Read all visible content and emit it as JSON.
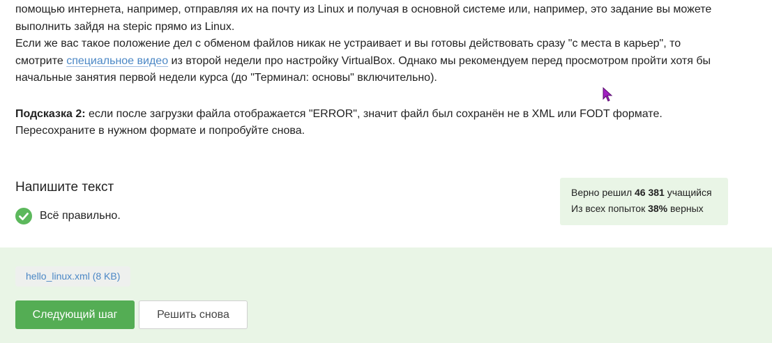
{
  "step_text": {
    "para1_line1": "помощью интернета, например, отправляя их на почту из Linux и получая в основной системе или, например, это задание вы можете",
    "para1_line2": "выполнить зайдя на stepic прямо из Linux.",
    "para2_part1": "Если же вас такое положение дел с обменом файлов никак не устраивает и вы готовы действовать сразу \"с места в карьер\", то",
    "para2_part2_before_link": "смотрите ",
    "para2_link": "специальное видео",
    "para2_part2_after_link": " из второй недели про настройку VirtualBox. Однако мы рекомендуем перед просмотром пройти хотя бы",
    "para2_part3": "начальные занятия первой недели курса (до \"Терминал: основы\" включительно).",
    "hint_label": "Подсказка 2:",
    "hint_text": " если после загрузки файла отображается \"ERROR\", значит файл был сохранён не в XML или FODT формате.",
    "hint_text2": "Пересохраните в нужном формате и попробуйте снова."
  },
  "task": {
    "title": "Напишите текст",
    "result_text": "Всё правильно."
  },
  "stats": {
    "solved_prefix": "Верно решил ",
    "solved_count": "46 381",
    "solved_suffix": " учащийся",
    "attempts_prefix": "Из всех попыток ",
    "attempts_percent": "38%",
    "attempts_suffix": " верных"
  },
  "footer": {
    "file_chip": "hello_linux.xml (8 KB)",
    "next_button": "Следующий шаг",
    "retry_button": "Решить снова"
  },
  "colors": {
    "accent_green": "#54ad54",
    "success_bg": "#e9f5e6",
    "link_blue": "#4b87c5",
    "cursor_purple": "#a020c0"
  },
  "icons": {
    "check": "check-circle-icon",
    "cursor": "mouse-cursor-icon"
  }
}
